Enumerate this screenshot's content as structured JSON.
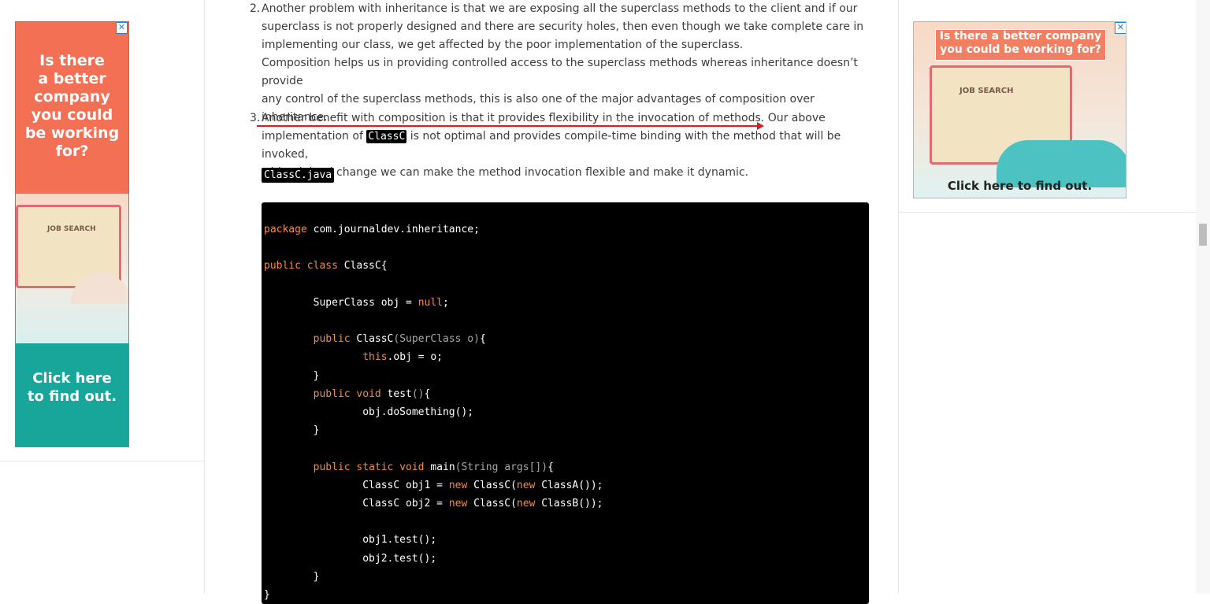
{
  "left_ad": {
    "headline": [
      "Is there",
      "a better",
      "company",
      "you could",
      "be working",
      "for?"
    ],
    "laptop_text": "JOB SEARCH",
    "cta": [
      "Click here",
      "to find out."
    ],
    "close": "✕"
  },
  "right_ad": {
    "headline": [
      "Is there a better company",
      "you could be working for?"
    ],
    "laptop_text": "JOB SEARCH",
    "cta": "Click here to find out.",
    "close": "✕"
  },
  "article": {
    "item2_number": "2.",
    "item2_lines": [
      "Another problem with inheritance is that we are exposing all the superclass methods to the client and if our",
      "superclass is not properly designed and there are security holes, then even though we take complete care in",
      "implementing our class, we get affected by the poor implementation of the superclass.",
      "Composition helps us in providing controlled access to the superclass methods whereas inheritance doesn’t provide",
      "any control of the superclass methods, this is also one of the major advantages of composition over inheritance."
    ],
    "item3_number": "3.",
    "item3_line1": "Another benefit with composition is that it provides flexibility in the invocation of methods. Our above",
    "item3_line2_pre": "implementation of ",
    "item3_line2_code": "ClassC",
    "item3_line2_post": " is not optimal and provides compile-time binding with the method that will be invoked,",
    "item3_line3": "with minimal change we can make the method invocation flexible and make it dynamic.",
    "filename": "ClassC.java"
  },
  "code": {
    "l01_kw": "package",
    "l01_rest": " com.journaldev.inheritance;",
    "l03_kw": "public class",
    "l03_rest": " ClassC{",
    "l05_indent": "        ",
    "l05_a": "SuperClass obj = ",
    "l05_null": "null",
    "l05_end": ";",
    "l07_indent": "        ",
    "l07_kw": "public",
    "l07_name": " ClassC",
    "l07_params": "(SuperClass o)",
    "l07_end": "{",
    "l08_indent": "                ",
    "l08_kw": "this",
    "l08_rest": ".obj = o;",
    "l09": "        }",
    "l10_indent": "        ",
    "l10_kw": "public void",
    "l10_name": " test",
    "l10_params": "()",
    "l10_end": "{",
    "l11": "                obj.doSomething();",
    "l12": "        }",
    "l14_indent": "        ",
    "l14_kw": "public static void",
    "l14_name": " main",
    "l14_params": "(String args[])",
    "l14_end": "{",
    "l15_a": "                ClassC obj1 = ",
    "l15_new1": "new",
    "l15_b": " ClassC(",
    "l15_new2": "new",
    "l15_c": " ClassA());",
    "l16_a": "                ClassC obj2 = ",
    "l16_new1": "new",
    "l16_b": " ClassC(",
    "l16_new2": "new",
    "l16_c": " ClassB());",
    "l18": "                obj1.test();",
    "l19": "                obj2.test();",
    "l20": "        }",
    "l21": "}"
  }
}
